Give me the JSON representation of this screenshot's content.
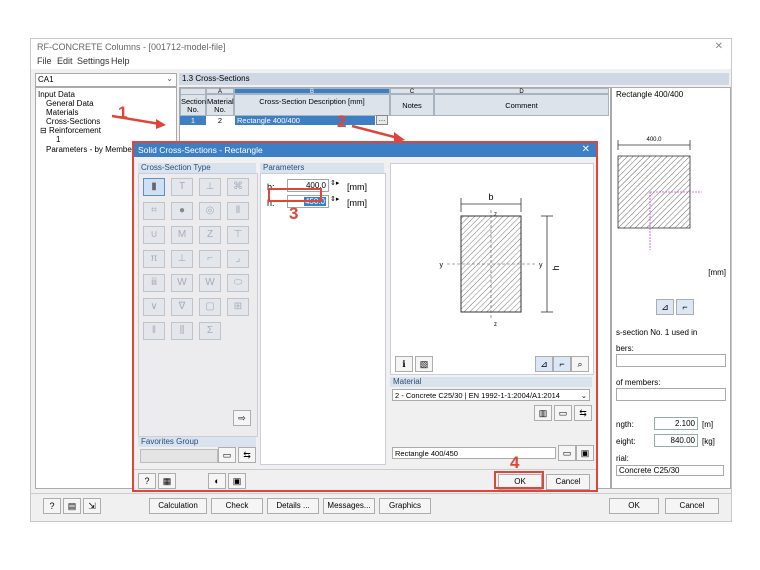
{
  "app": {
    "title": "RF-CONCRETE Columns - [001712-model-file]",
    "menu": [
      "File",
      "Edit",
      "Settings",
      "Help"
    ]
  },
  "left": {
    "combo": "CA1",
    "tree": [
      "Input Data",
      "General Data",
      "Materials",
      "Cross-Sections",
      "Reinforcement",
      "1",
      "Parameters - by Member"
    ]
  },
  "table": {
    "title": "1.3 Cross-Sections",
    "col_letters": [
      "A",
      "B",
      "C",
      "D"
    ],
    "headers": {
      "section": "Section No.",
      "material": "Material No.",
      "cross": "Cross-Section Description [mm]",
      "notes": "Notes",
      "comment": "Comment"
    },
    "row": {
      "no": "1",
      "material": "2",
      "description": "Rectangle 400/400"
    }
  },
  "right_pane": {
    "title": "Rectangle 400/400",
    "dim": "400.0",
    "unit": "[mm]",
    "used_in": "s-section No. 1 used in",
    "members": "bers:",
    "sets": "of members:",
    "length_label": "ngth:",
    "length_value": "2.100",
    "length_unit": "[m]",
    "weight_label": "eight:",
    "weight_value": "840.00",
    "weight_unit": "[kg]",
    "material_label": "rial:",
    "material_value": "Concrete C25/30"
  },
  "bottom": {
    "calculation": "Calculation",
    "check": "Check",
    "details": "Details ...",
    "messages": "Messages...",
    "graphics": "Graphics",
    "ok": "OK",
    "cancel": "Cancel"
  },
  "dialog": {
    "title": "Solid Cross-Sections - Rectangle",
    "type_header": "Cross-Section Type",
    "params_header": "Parameters",
    "b_label": "b:",
    "b_value": "400.0",
    "h_label": "h:",
    "h_value": "450.0",
    "unit": "[mm]",
    "favorites": "Favorites Group",
    "material_header": "Material",
    "material_value": "2 - Concrete C25/30 | EN 1992-1-1:2004/A1:2014",
    "name_value": "Rectangle 400/450",
    "ok": "OK",
    "cancel": "Cancel",
    "drawing": {
      "b": "b",
      "h": "h",
      "y": "y",
      "z": "z"
    }
  },
  "annotations": [
    "1",
    "2",
    "3",
    "4"
  ],
  "colors": {
    "accent": "#e0453a",
    "dialog_title": "#3c7fc4"
  }
}
